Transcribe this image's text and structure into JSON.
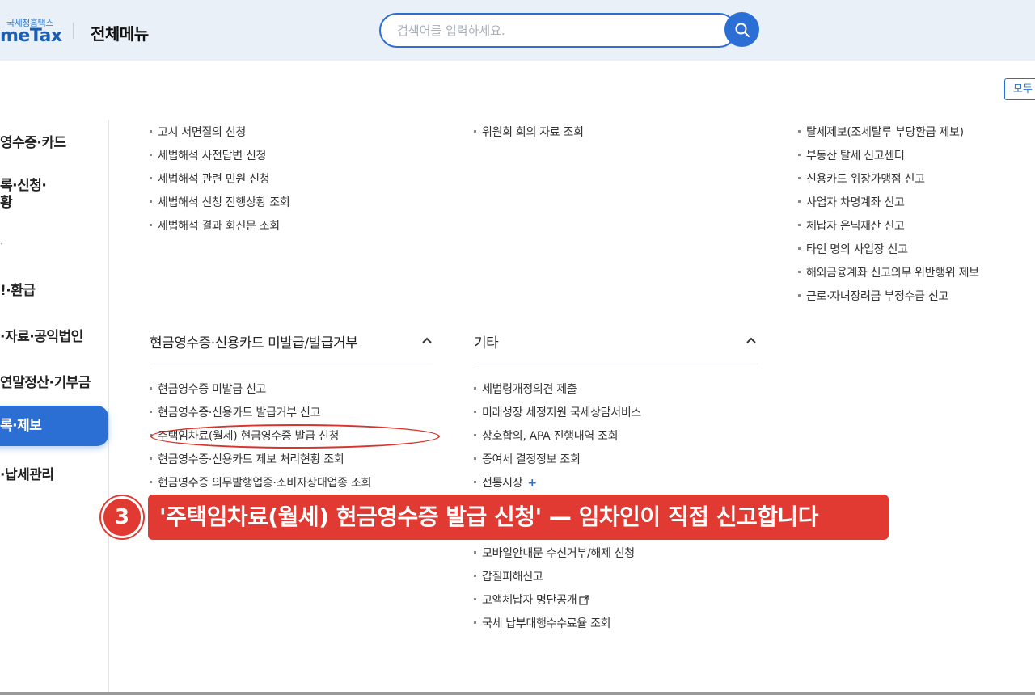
{
  "header": {
    "logo_sub": "국세청홈택스",
    "logo_main": "meTax",
    "page_title": "전체메뉴",
    "search_placeholder": "검색어를 입력하세요.",
    "all_button": "모두"
  },
  "sidebar": {
    "items": [
      {
        "label": "영수증·카드"
      },
      {
        "label": "록·신청·"
      },
      {
        "label": "황"
      },
      {
        "label": "·"
      },
      {
        "label": "!·환급"
      },
      {
        "label": "·자료·공익법인"
      },
      {
        "label": "연말정산·기부금"
      },
      {
        "label": "록·제보",
        "active": true
      },
      {
        "label": "·납세관리"
      }
    ]
  },
  "col1_top": [
    "고시 서면질의 신청",
    "세법해석 사전답변 신청",
    "세법해석 관련 민원 신청",
    "세법해석 신청 진행상황 조회",
    "세법해석 결과 회신문 조회"
  ],
  "col2_top": [
    "위원회 회의 자료 조회"
  ],
  "col3_top": [
    "탈세제보(조세탈루 부당환급 제보)",
    "부동산 탈세 신고센터",
    "신용카드 위장가맹점 신고",
    "사업자 차명계좌 신고",
    "체납자 은닉재산 신고",
    "타인 명의 사업장 신고",
    "해외금융계좌 신고의무 위반행위 제보",
    "근로·자녀장려금 부정수급 신고"
  ],
  "section_cash": {
    "title": "현금영수증·신용카드 미발급/발급거부",
    "items": [
      "현금영수증 미발급 신고",
      "현금영수증·신용카드 발급거부 신고",
      "주택임차료(월세) 현금영수증 발급 신청",
      "현금영수증·신용카드 제보 처리현황 조회",
      "현금영수증 의무발행업종·소비자상대업종 조회"
    ]
  },
  "section_etc": {
    "title": "기타",
    "items_top": [
      "세법령개정의견 제출",
      "미래성장 세정지원 국세상담서비스",
      "상호합의, APA 진행내역 조회",
      "증여세 결정정보 조회",
      "전통시장"
    ],
    "plus": "+",
    "items_bottom": [
      "모바일안내문 수신거부/해제 신청",
      "갑질피해신고",
      "고액체납자 명단공개",
      "국세 납부대행수수료율 조회"
    ]
  },
  "annotation": {
    "step_number": "3",
    "banner_text": "'주택임차료(월세) 현금영수증 발급 신청' — 임차인이 직접 신고합니다",
    "colors": {
      "accent": "#e03a32",
      "brand": "#2b6fd5"
    }
  }
}
